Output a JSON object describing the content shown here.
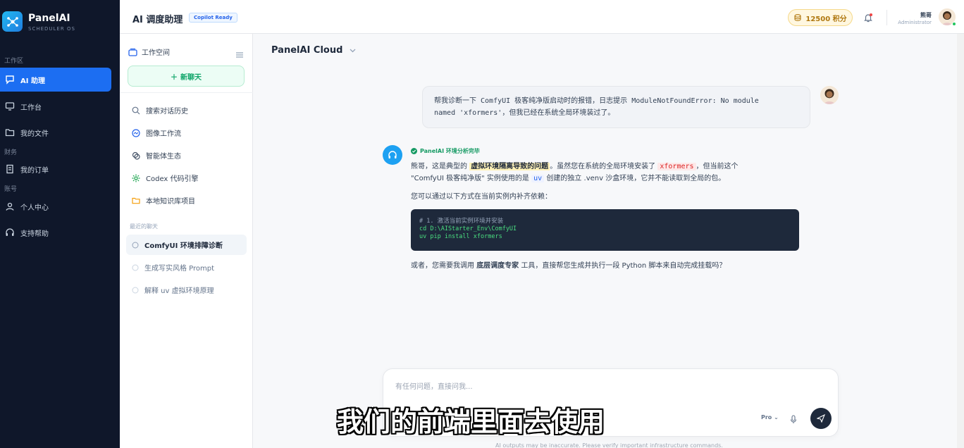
{
  "brand": {
    "name": "PanelAI",
    "subtitle": "SCHEDULER OS"
  },
  "sidebar": {
    "sections": {
      "workspace": "工作区",
      "finance": "财务",
      "account": "账号"
    },
    "items": [
      {
        "label": "AI 助理",
        "icon": "chat-icon"
      },
      {
        "label": "工作台",
        "icon": "monitor-icon"
      },
      {
        "label": "我的文件",
        "icon": "folder-icon"
      },
      {
        "label": "我的订单",
        "icon": "receipt-icon"
      },
      {
        "label": "个人中心",
        "icon": "user-icon"
      },
      {
        "label": "支持帮助",
        "icon": "headset-icon"
      }
    ]
  },
  "header": {
    "title": "AI 调度助理",
    "badge": "Copilot Ready",
    "points": "12500 积分",
    "user_name": "熊哥",
    "user_role": "Administrator"
  },
  "panel": {
    "title": "工作空间",
    "new_chat": "新聊天",
    "items": [
      {
        "label": "搜索对话历史",
        "icon": "search-icon"
      },
      {
        "label": "图像工作流",
        "icon": "image-workflow-icon"
      },
      {
        "label": "智能体生态",
        "icon": "agent-icon"
      },
      {
        "label": "Codex 代码引擎",
        "icon": "gear-icon"
      },
      {
        "label": "本地知识库项目",
        "icon": "folder-icon"
      }
    ],
    "recent_header": "最近的聊天",
    "recent": [
      {
        "label": "ComfyUI 环境排障诊断"
      },
      {
        "label": "生成写实风格 Prompt"
      },
      {
        "label": "解释 uv 虚拟环境原理"
      }
    ]
  },
  "chat": {
    "model": "PanelAI Cloud",
    "user_message_1": "帮我诊断一下 ComfyUI 极客纯净版启动时的报错，日志提示 ModuleNotFoundError: No module",
    "user_message_2": "named 'xformers'，但我已经在系统全局环境装过了。",
    "status": "PanelAI 环境分析完毕",
    "answer": {
      "p1a": "熊哥，这是典型的 ",
      "p1hl": "虚拟环境隔离导致的问题",
      "p1b": "。虽然您在系统的全局环境安装了 ",
      "p1code": "xformers",
      "p1c": "，但当前这个",
      "p1d": "\"ComfyUI 极客纯净版\" 实例使用的是 ",
      "p1code2": "uv",
      "p1e": " 创建的独立 .venv 沙盒环境，它并不能读取到全局的包。",
      "p2": "您可以通过以下方式在当前实例内补齐依赖："
    },
    "code": [
      "# 1. 激活当前实例环境并安装",
      "cd D:\\AIStarter_Env\\ComfyUI",
      "uv pip install xformers"
    ],
    "follow_a": "或者，您需要我调用 ",
    "follow_b": "底层调度专家",
    "follow_c": " 工具，直接帮您生成并执行一段 Python 脚本来自动完成挂载吗？"
  },
  "input": {
    "placeholder": "有任何问题，直接问我...",
    "mode": "Pro",
    "disclaimer": "AI outputs may be inaccurate. Please verify important infrastructure commands."
  },
  "overlay_subtitle": "我们的前端里面去使用"
}
